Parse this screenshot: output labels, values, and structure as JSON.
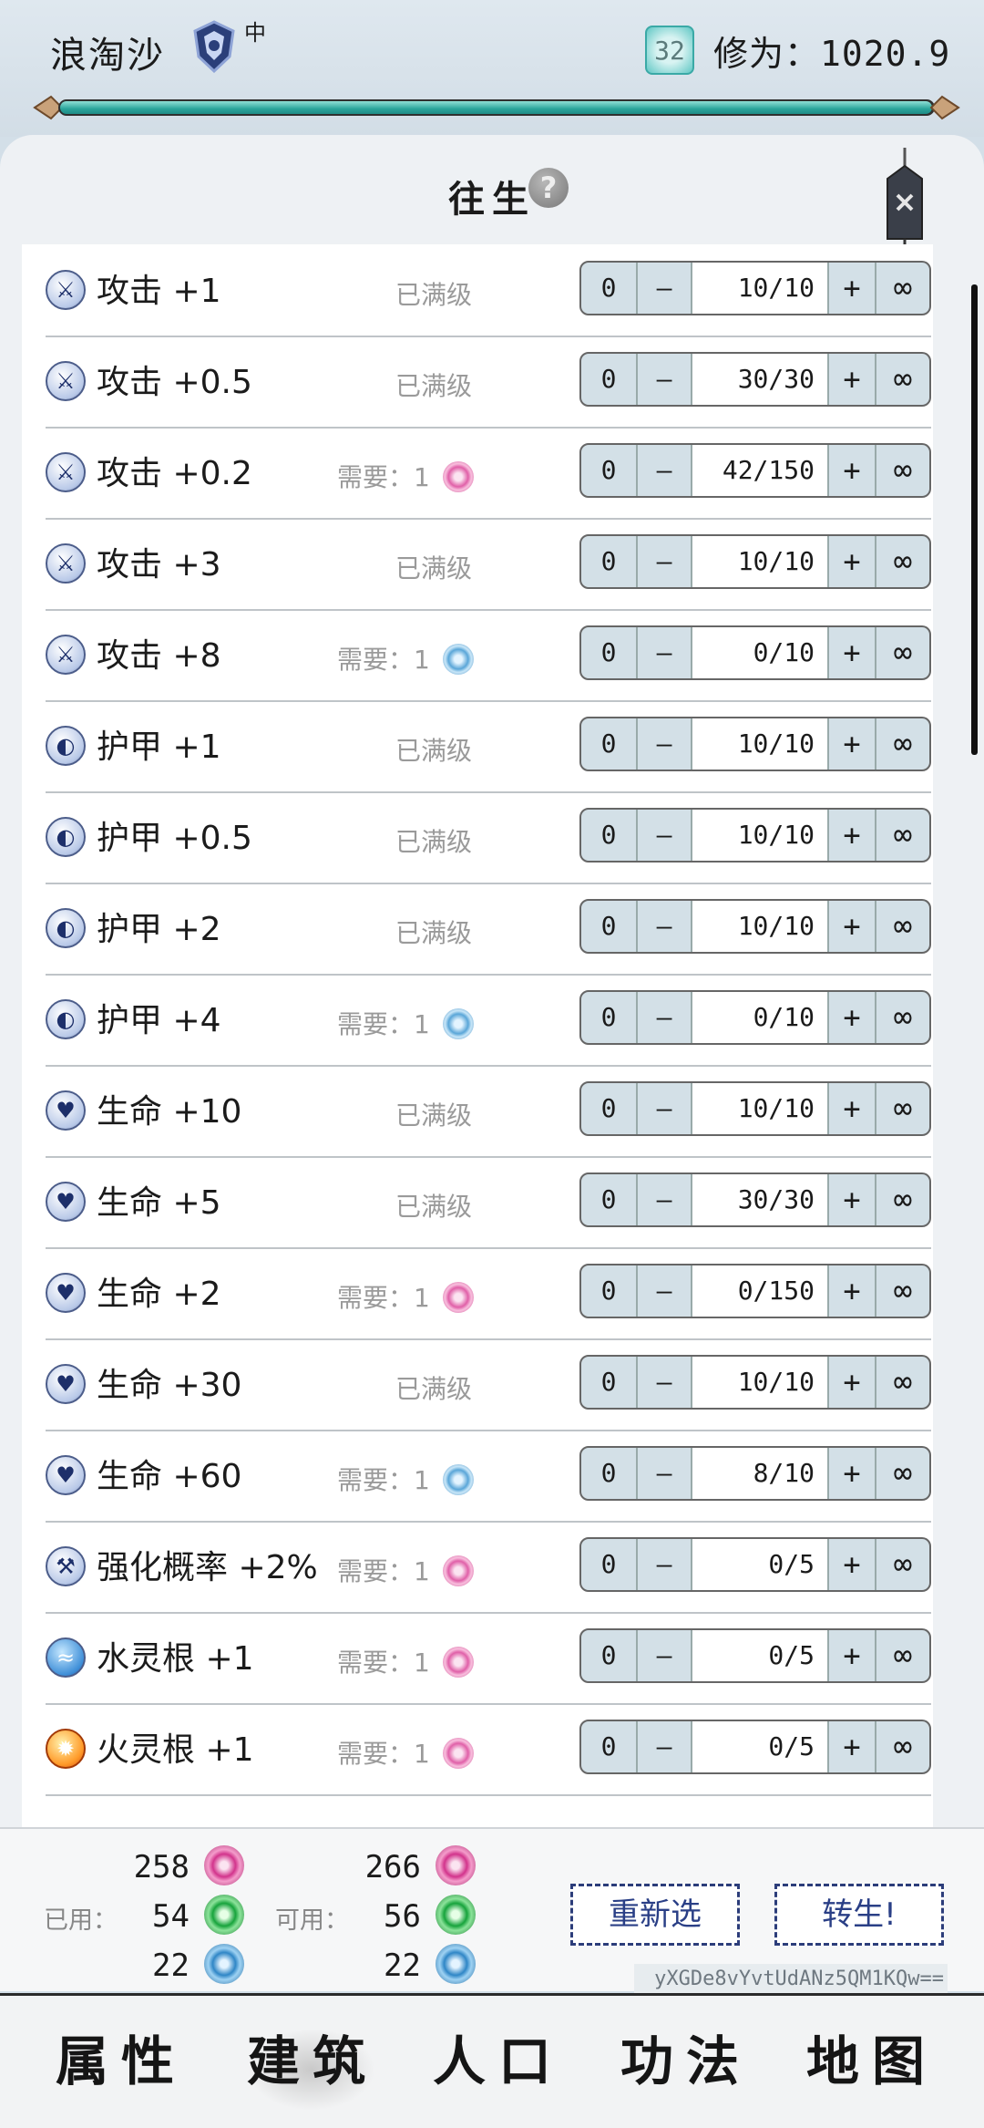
{
  "header": {
    "player_name": "浪淘沙",
    "rank_text": "中",
    "level": "32",
    "cultivation": "修为：1020.9",
    "exp_progress": 0.995
  },
  "panel": {
    "title": "往生",
    "help": "?"
  },
  "upgrades": [
    {
      "label": "攻击 +1",
      "icon": "attack-icon",
      "status": "已满级",
      "min": "0",
      "dec": "–",
      "value": "10/10",
      "inc": "+",
      "max": "∞"
    },
    {
      "label": "攻击 +0.5",
      "icon": "attack-icon",
      "status": "已满级",
      "min": "0",
      "dec": "–",
      "value": "30/30",
      "inc": "+",
      "max": "∞"
    },
    {
      "label": "攻击 +0.2",
      "icon": "attack-icon",
      "need": "需要：1",
      "orb": "pink",
      "min": "0",
      "dec": "–",
      "value": "42/150",
      "inc": "+",
      "max": "∞"
    },
    {
      "label": "攻击 +3",
      "icon": "attack-icon",
      "status": "已满级",
      "min": "0",
      "dec": "–",
      "value": "10/10",
      "inc": "+",
      "max": "∞"
    },
    {
      "label": "攻击 +8",
      "icon": "attack-icon",
      "need": "需要：1",
      "orb": "blue",
      "min": "0",
      "dec": "–",
      "value": "0/10",
      "inc": "+",
      "max": "∞"
    },
    {
      "label": "护甲 +1",
      "icon": "shield-icon",
      "status": "已满级",
      "min": "0",
      "dec": "–",
      "value": "10/10",
      "inc": "+",
      "max": "∞"
    },
    {
      "label": "护甲 +0.5",
      "icon": "shield-icon",
      "status": "已满级",
      "min": "0",
      "dec": "–",
      "value": "10/10",
      "inc": "+",
      "max": "∞"
    },
    {
      "label": "护甲 +2",
      "icon": "shield-icon",
      "status": "已满级",
      "min": "0",
      "dec": "–",
      "value": "10/10",
      "inc": "+",
      "max": "∞"
    },
    {
      "label": "护甲 +4",
      "icon": "shield-icon",
      "need": "需要：1",
      "orb": "blue",
      "min": "0",
      "dec": "–",
      "value": "0/10",
      "inc": "+",
      "max": "∞"
    },
    {
      "label": "生命 +10",
      "icon": "heart-icon",
      "status": "已满级",
      "min": "0",
      "dec": "–",
      "value": "10/10",
      "inc": "+",
      "max": "∞"
    },
    {
      "label": "生命 +5",
      "icon": "heart-icon",
      "status": "已满级",
      "min": "0",
      "dec": "–",
      "value": "30/30",
      "inc": "+",
      "max": "∞"
    },
    {
      "label": "生命 +2",
      "icon": "heart-icon",
      "need": "需要：1",
      "orb": "pink",
      "min": "0",
      "dec": "–",
      "value": "0/150",
      "inc": "+",
      "max": "∞"
    },
    {
      "label": "生命 +30",
      "icon": "heart-icon",
      "status": "已满级",
      "min": "0",
      "dec": "–",
      "value": "10/10",
      "inc": "+",
      "max": "∞"
    },
    {
      "label": "生命 +60",
      "icon": "heart-icon",
      "need": "需要：1",
      "orb": "blue",
      "min": "0",
      "dec": "–",
      "value": "8/10",
      "inc": "+",
      "max": "∞"
    },
    {
      "label": "强化概率 +2%",
      "icon": "hammer-icon",
      "need": "需要：1",
      "orb": "pink",
      "min": "0",
      "dec": "–",
      "value": "0/5",
      "inc": "+",
      "max": "∞"
    },
    {
      "label": "水灵根 +1",
      "icon": "water-icon",
      "need": "需要：1",
      "orb": "pink",
      "min": "0",
      "dec": "–",
      "value": "0/5",
      "inc": "+",
      "max": "∞"
    },
    {
      "label": "火灵根 +1",
      "icon": "fire-icon",
      "need": "需要：1",
      "orb": "pink",
      "min": "0",
      "dec": "–",
      "value": "0/5",
      "inc": "+",
      "max": "∞"
    }
  ],
  "resources": {
    "used_label": "已用：",
    "available_label": "可用：",
    "used": [
      {
        "value": "258",
        "orb": "pink"
      },
      {
        "value": "54",
        "orb": "green"
      },
      {
        "value": "22",
        "orb": "blue"
      }
    ],
    "available": [
      {
        "value": "266",
        "orb": "pink"
      },
      {
        "value": "56",
        "orb": "green"
      },
      {
        "value": "22",
        "orb": "blue"
      }
    ]
  },
  "actions": {
    "reselect": "重新选",
    "reincarnate": "转生!"
  },
  "code": "yXGDe8vYvtUdANz5QM1KQw==",
  "nav": [
    {
      "label": "属性",
      "name": "nav-attributes"
    },
    {
      "label": "建筑",
      "name": "nav-buildings",
      "active": true
    },
    {
      "label": "人口",
      "name": "nav-population"
    },
    {
      "label": "功法",
      "name": "nav-techniques"
    },
    {
      "label": "地图",
      "name": "nav-map"
    }
  ],
  "colors": {
    "accent": "#2a3f86",
    "exp_bar": "#2aa49b"
  }
}
